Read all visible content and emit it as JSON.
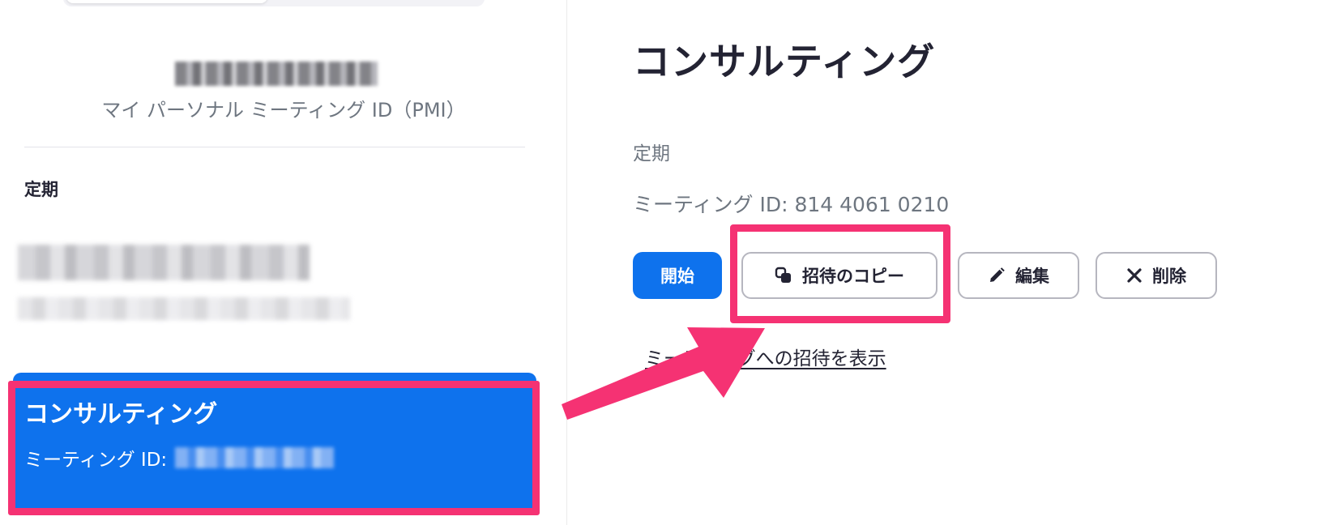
{
  "left_panel": {
    "pmi_label": "マイ パーソナル ミーティング ID（PMI）",
    "section_title": "定期",
    "selected_meeting": {
      "title": "コンサルティング",
      "id_label": "ミーティング ID:"
    }
  },
  "detail": {
    "title": "コンサルティング",
    "recurrence": "定期",
    "meeting_id": "ミーティング ID: 814 4061 0210",
    "buttons": {
      "start": "開始",
      "copy_invite": "招待のコピー",
      "edit": "編集",
      "delete": "削除"
    },
    "invite_link": "ミーティングへの招待を表示"
  },
  "annotation": {
    "highlight_color": "#f53273"
  },
  "colors": {
    "accent": "#0e72ed",
    "text": "#232333",
    "muted": "#6e7680"
  }
}
